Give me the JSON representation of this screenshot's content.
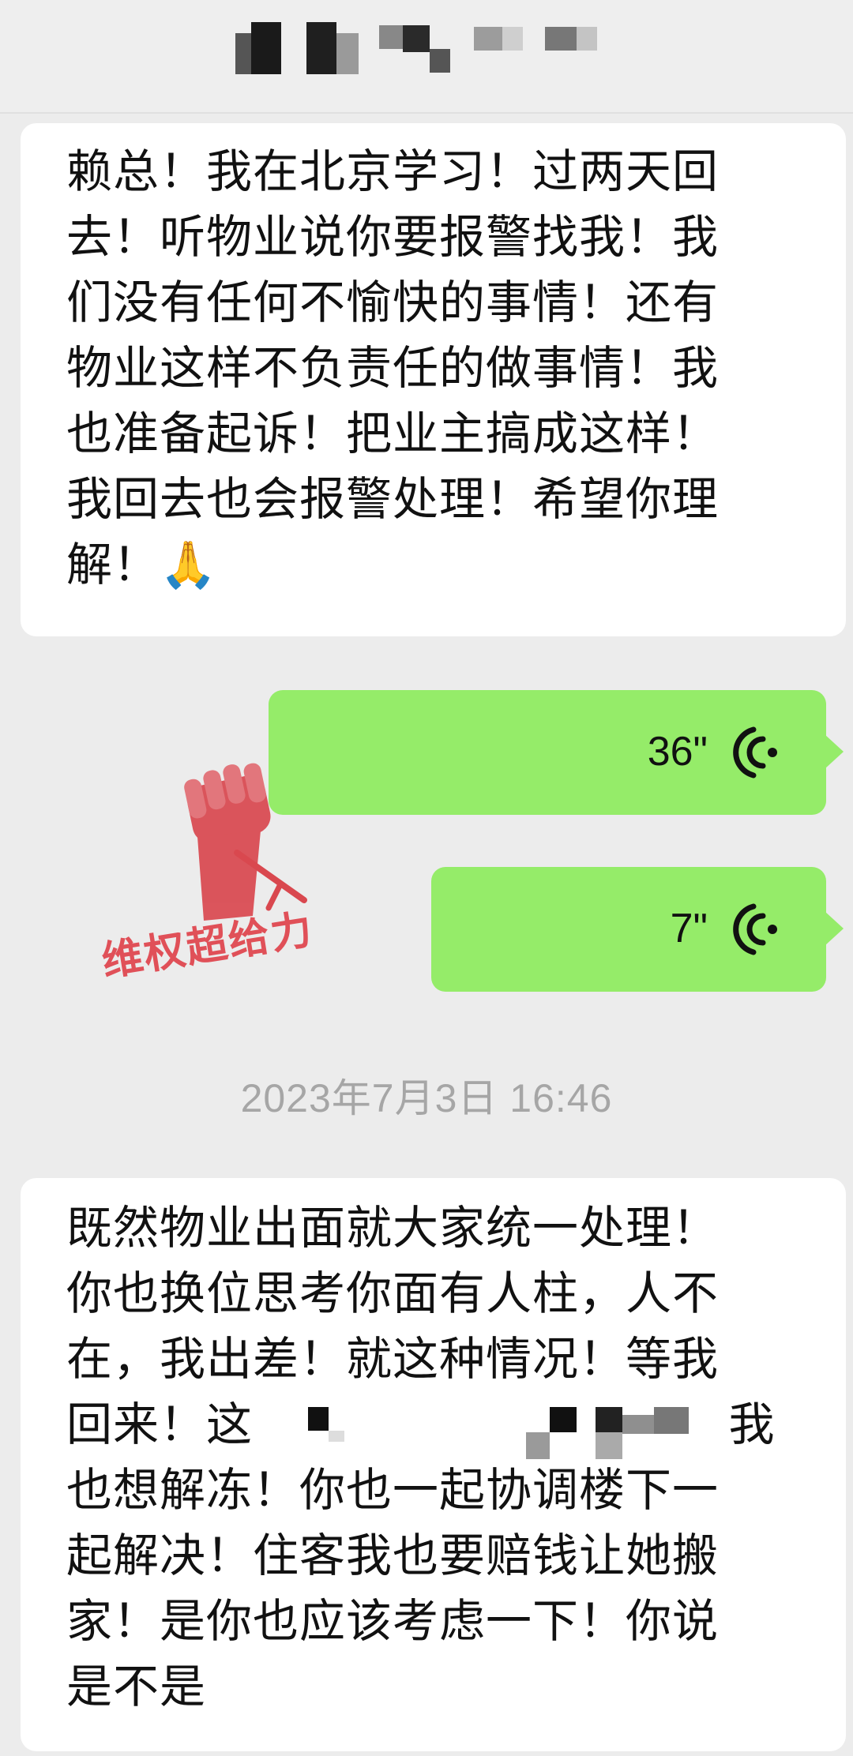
{
  "messages": [
    {
      "direction": "incoming",
      "lines": [
        "赖总！我在北京学习！过两天回",
        "去！听物业说你要报警找我！我",
        "们没有任何不愉快的事情！还有",
        "物业这样不负责任的做事情！我",
        "也准备起诉！把业主搞成这样！",
        "我回去也会报警处理！希望你理",
        "解！🙏"
      ]
    },
    {
      "direction": "outgoing",
      "type": "voice",
      "duration": "36\"",
      "icon": "voice-wave-icon"
    },
    {
      "direction": "outgoing",
      "type": "voice",
      "duration": "7\"",
      "icon": "voice-wave-icon"
    },
    {
      "direction": "incoming",
      "lines": [
        "既然物业出面就大家统一处理！",
        "你也换位思考你面有人柱，人不",
        "在，我出差！就这种情况！等我",
        "回来！这                               我",
        "也想解冻！你也一起协调楼下一",
        "起解决！住客我也要赔钱让她搬",
        "家！是你也应该考虑一下！你说",
        "是不是"
      ]
    }
  ],
  "timestamp": "2023年7月3日 16:46",
  "watermark": {
    "text": "维权超给力",
    "icon": "raised-fist-icon"
  },
  "colors": {
    "background": "#ececec",
    "incoming_bubble": "#ffffff",
    "outgoing_bubble": "#95ec69",
    "timestamp": "#a6a6a6",
    "watermark": "#e05058"
  }
}
